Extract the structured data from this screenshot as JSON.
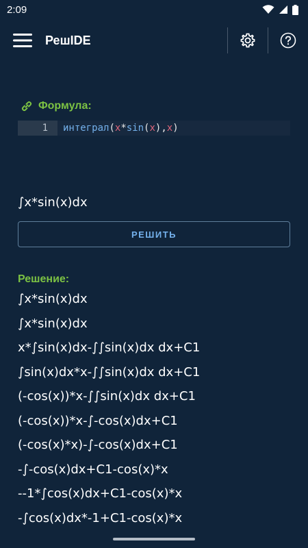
{
  "status": {
    "time": "2:09"
  },
  "app": {
    "title": "РешIDE"
  },
  "formula": {
    "label": "Формула:",
    "line_number": "1",
    "tokens": {
      "func": "интеграл",
      "open": "(",
      "var1": "x",
      "op": "*",
      "sin": "sin",
      "open2": "(",
      "var2": "x",
      "close2": ")",
      "comma": ",",
      "var3": "x",
      "close": ")"
    }
  },
  "preview": "∫x*sin(x)dx",
  "solve_button": "РЕШИТЬ",
  "solution": {
    "label": "Решение:",
    "steps": [
      "∫x*sin(x)dx",
      "∫x*sin(x)dx",
      "x*∫sin(x)dx-∫∫sin(x)dx dx+C1",
      "∫sin(x)dx*x-∫∫sin(x)dx dx+C1",
      "(-cos(x))*x-∫∫sin(x)dx dx+C1",
      "(-cos(x))*x-∫-cos(x)dx+C1",
      "(-cos(x)*x)-∫-cos(x)dx+C1",
      "-∫-cos(x)dx+C1-cos(x)*x",
      "--1*∫cos(x)dx+C1-cos(x)*x",
      "-∫cos(x)dx*-1+C1-cos(x)*x"
    ]
  },
  "colors": {
    "background": "#10243a",
    "accent_green": "#7cc243",
    "accent_blue": "#74b1ec",
    "code_var": "#e0667b"
  },
  "icons": {
    "menu": "hamburger-menu-icon",
    "settings": "gear-icon",
    "help": "help-icon",
    "link": "link-icon",
    "wifi": "wifi-icon",
    "signal": "signal-icon",
    "battery": "battery-icon"
  }
}
